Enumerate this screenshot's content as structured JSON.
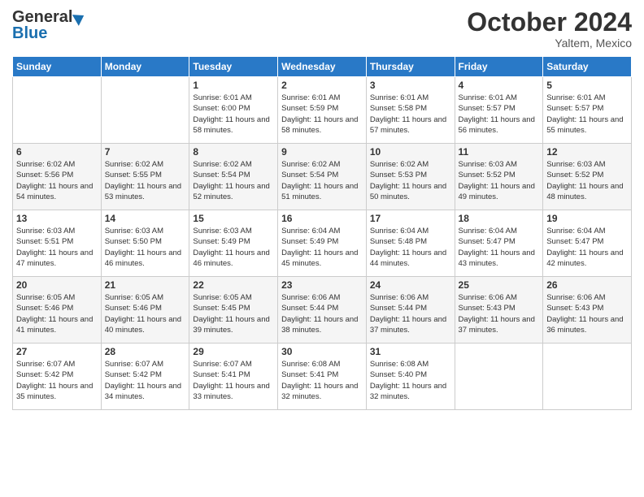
{
  "header": {
    "logo_line1": "General",
    "logo_line2": "Blue",
    "month": "October 2024",
    "location": "Yaltem, Mexico"
  },
  "weekdays": [
    "Sunday",
    "Monday",
    "Tuesday",
    "Wednesday",
    "Thursday",
    "Friday",
    "Saturday"
  ],
  "weeks": [
    [
      {
        "day": "",
        "info": ""
      },
      {
        "day": "",
        "info": ""
      },
      {
        "day": "1",
        "info": "Sunrise: 6:01 AM\nSunset: 6:00 PM\nDaylight: 11 hours and 58 minutes."
      },
      {
        "day": "2",
        "info": "Sunrise: 6:01 AM\nSunset: 5:59 PM\nDaylight: 11 hours and 58 minutes."
      },
      {
        "day": "3",
        "info": "Sunrise: 6:01 AM\nSunset: 5:58 PM\nDaylight: 11 hours and 57 minutes."
      },
      {
        "day": "4",
        "info": "Sunrise: 6:01 AM\nSunset: 5:57 PM\nDaylight: 11 hours and 56 minutes."
      },
      {
        "day": "5",
        "info": "Sunrise: 6:01 AM\nSunset: 5:57 PM\nDaylight: 11 hours and 55 minutes."
      }
    ],
    [
      {
        "day": "6",
        "info": "Sunrise: 6:02 AM\nSunset: 5:56 PM\nDaylight: 11 hours and 54 minutes."
      },
      {
        "day": "7",
        "info": "Sunrise: 6:02 AM\nSunset: 5:55 PM\nDaylight: 11 hours and 53 minutes."
      },
      {
        "day": "8",
        "info": "Sunrise: 6:02 AM\nSunset: 5:54 PM\nDaylight: 11 hours and 52 minutes."
      },
      {
        "day": "9",
        "info": "Sunrise: 6:02 AM\nSunset: 5:54 PM\nDaylight: 11 hours and 51 minutes."
      },
      {
        "day": "10",
        "info": "Sunrise: 6:02 AM\nSunset: 5:53 PM\nDaylight: 11 hours and 50 minutes."
      },
      {
        "day": "11",
        "info": "Sunrise: 6:03 AM\nSunset: 5:52 PM\nDaylight: 11 hours and 49 minutes."
      },
      {
        "day": "12",
        "info": "Sunrise: 6:03 AM\nSunset: 5:52 PM\nDaylight: 11 hours and 48 minutes."
      }
    ],
    [
      {
        "day": "13",
        "info": "Sunrise: 6:03 AM\nSunset: 5:51 PM\nDaylight: 11 hours and 47 minutes."
      },
      {
        "day": "14",
        "info": "Sunrise: 6:03 AM\nSunset: 5:50 PM\nDaylight: 11 hours and 46 minutes."
      },
      {
        "day": "15",
        "info": "Sunrise: 6:03 AM\nSunset: 5:49 PM\nDaylight: 11 hours and 46 minutes."
      },
      {
        "day": "16",
        "info": "Sunrise: 6:04 AM\nSunset: 5:49 PM\nDaylight: 11 hours and 45 minutes."
      },
      {
        "day": "17",
        "info": "Sunrise: 6:04 AM\nSunset: 5:48 PM\nDaylight: 11 hours and 44 minutes."
      },
      {
        "day": "18",
        "info": "Sunrise: 6:04 AM\nSunset: 5:47 PM\nDaylight: 11 hours and 43 minutes."
      },
      {
        "day": "19",
        "info": "Sunrise: 6:04 AM\nSunset: 5:47 PM\nDaylight: 11 hours and 42 minutes."
      }
    ],
    [
      {
        "day": "20",
        "info": "Sunrise: 6:05 AM\nSunset: 5:46 PM\nDaylight: 11 hours and 41 minutes."
      },
      {
        "day": "21",
        "info": "Sunrise: 6:05 AM\nSunset: 5:46 PM\nDaylight: 11 hours and 40 minutes."
      },
      {
        "day": "22",
        "info": "Sunrise: 6:05 AM\nSunset: 5:45 PM\nDaylight: 11 hours and 39 minutes."
      },
      {
        "day": "23",
        "info": "Sunrise: 6:06 AM\nSunset: 5:44 PM\nDaylight: 11 hours and 38 minutes."
      },
      {
        "day": "24",
        "info": "Sunrise: 6:06 AM\nSunset: 5:44 PM\nDaylight: 11 hours and 37 minutes."
      },
      {
        "day": "25",
        "info": "Sunrise: 6:06 AM\nSunset: 5:43 PM\nDaylight: 11 hours and 37 minutes."
      },
      {
        "day": "26",
        "info": "Sunrise: 6:06 AM\nSunset: 5:43 PM\nDaylight: 11 hours and 36 minutes."
      }
    ],
    [
      {
        "day": "27",
        "info": "Sunrise: 6:07 AM\nSunset: 5:42 PM\nDaylight: 11 hours and 35 minutes."
      },
      {
        "day": "28",
        "info": "Sunrise: 6:07 AM\nSunset: 5:42 PM\nDaylight: 11 hours and 34 minutes."
      },
      {
        "day": "29",
        "info": "Sunrise: 6:07 AM\nSunset: 5:41 PM\nDaylight: 11 hours and 33 minutes."
      },
      {
        "day": "30",
        "info": "Sunrise: 6:08 AM\nSunset: 5:41 PM\nDaylight: 11 hours and 32 minutes."
      },
      {
        "day": "31",
        "info": "Sunrise: 6:08 AM\nSunset: 5:40 PM\nDaylight: 11 hours and 32 minutes."
      },
      {
        "day": "",
        "info": ""
      },
      {
        "day": "",
        "info": ""
      }
    ]
  ]
}
